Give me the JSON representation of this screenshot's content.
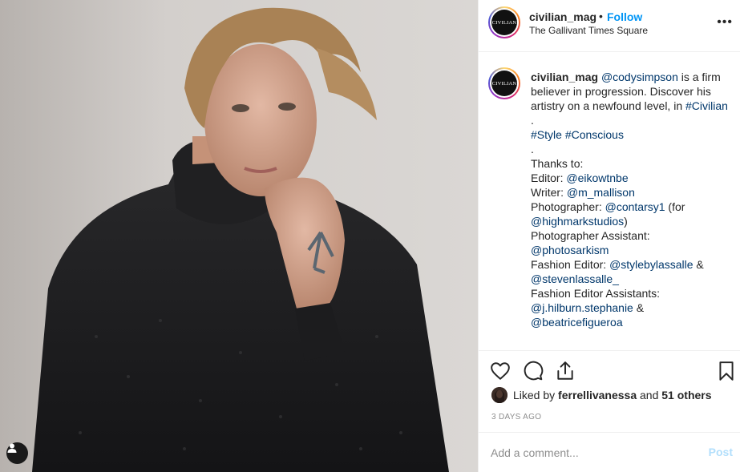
{
  "post": {
    "username": "civilian_mag",
    "follow_label": "Follow",
    "dot": "•",
    "location": "The Gallivant Times Square",
    "avatar_text": "CIVILIAN",
    "more_icon": "more-options-icon"
  },
  "caption": {
    "username": "civilian_mag",
    "mention_main": "@codysimpson",
    "text_1": " is a firm believer in progression. Discover his artistry on a newfound level, in ",
    "hashtag_civilian": "#Civilian",
    "dot_1": ".",
    "hashtag_style": "#Style",
    "hashtag_conscious": "#Conscious",
    "dot_2": ".",
    "thanks": "Thanks to:",
    "editor_label": "Editor: ",
    "editor": "@eikowtnbe",
    "writer_label": "Writer: ",
    "writer": "@m_mallison",
    "photographer_label": "Photographer: ",
    "photographer": "@contarsy1",
    "for_text": " (for ",
    "studio": "@highmarkstudios",
    "close_paren": ")",
    "photo_assistant_label": "Photographer Assistant:",
    "photo_assistant": "@photosarkism",
    "fashion_editor_label": "Fashion Editor: ",
    "fashion_editor_1": "@stylebylassalle",
    "amp_1": " &",
    "fashion_editor_2": "@stevenlassalle_",
    "fashion_assistants_label": "Fashion Editor Assistants:",
    "fashion_assistant_1": "@j.hilburn.stephanie",
    "amp_2": " &",
    "fashion_assistant_2": "@beatricefigueroa"
  },
  "actions": {
    "like_icon": "heart-icon",
    "comment_icon": "comment-icon",
    "share_icon": "share-icon",
    "save_icon": "bookmark-icon"
  },
  "likes": {
    "prefix": "Liked by ",
    "user": "ferrellivanessa",
    "middle": " and ",
    "others": "51 others"
  },
  "date": "3 DAYS AGO",
  "comment": {
    "placeholder": "Add a comment...",
    "post_label": "Post"
  },
  "colors": {
    "link": "#00376b",
    "follow": "#0095f6",
    "post_disabled": "#b2dffc",
    "muted": "#8e8e8e"
  }
}
